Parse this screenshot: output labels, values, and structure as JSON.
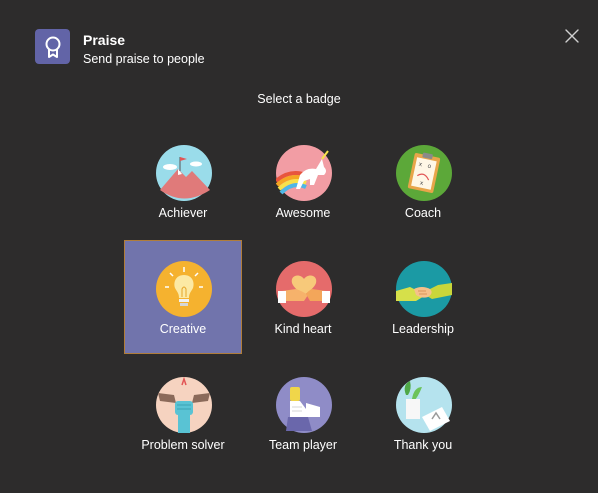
{
  "header": {
    "app_icon": "ribbon-badge-icon",
    "title": "Praise",
    "subtitle": "Send praise to people",
    "close_icon": "close-icon"
  },
  "prompt": "Select a badge",
  "badges": [
    {
      "label": "Achiever",
      "icon": "mountain-flag-icon",
      "color": "#9adcea"
    },
    {
      "label": "Awesome",
      "icon": "unicorn-rainbow-icon",
      "color": "#f29da4"
    },
    {
      "label": "Coach",
      "icon": "clipboard-playbook-icon",
      "color": "#5ca839"
    },
    {
      "label": "Creative",
      "icon": "lightbulb-icon",
      "color": "#f5b22f",
      "selected": true
    },
    {
      "label": "Kind heart",
      "icon": "heart-hands-icon",
      "color": "#e56b6b"
    },
    {
      "label": "Leadership",
      "icon": "handshake-icon",
      "color": "#1b9aa4"
    },
    {
      "label": "Problem solver",
      "icon": "raised-fist-icon",
      "color": "#f6d3c0"
    },
    {
      "label": "Team player",
      "icon": "fist-bump-icon",
      "color": "#8f8cc7"
    },
    {
      "label": "Thank you",
      "icon": "gift-plant-icon",
      "color": "#b5e3ee"
    }
  ],
  "colors": {
    "background": "#2d2c2c",
    "accent": "#6264a7",
    "selected_background": "#7174ac",
    "selected_border": "#b07d3a"
  }
}
